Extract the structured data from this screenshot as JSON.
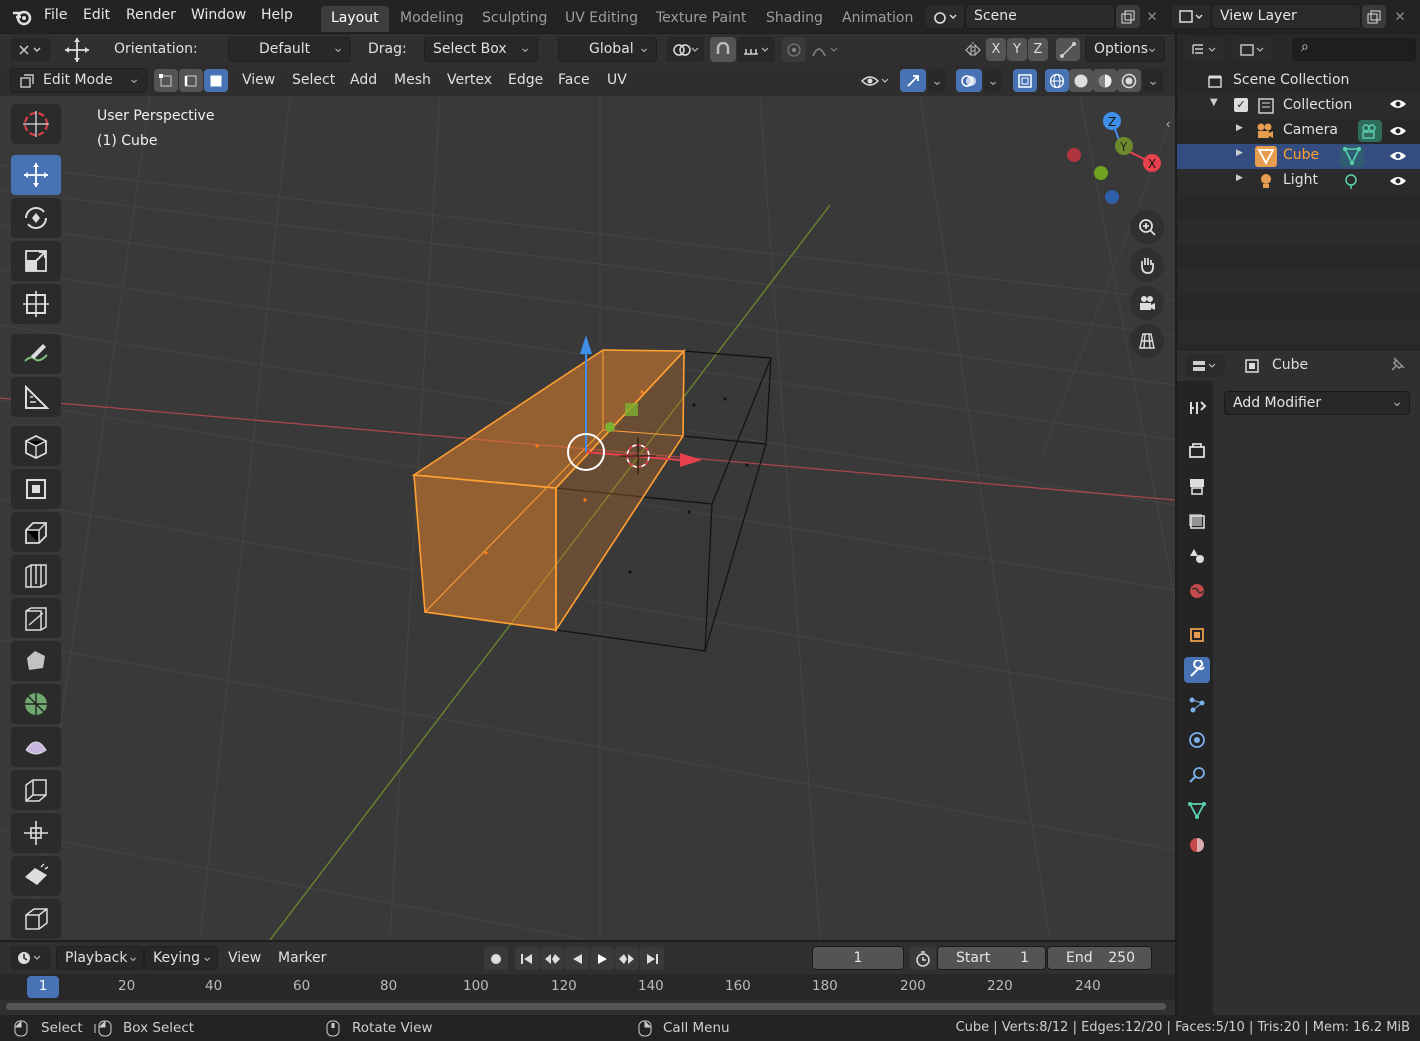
{
  "topbar": {
    "menus": [
      "File",
      "Edit",
      "Render",
      "Window",
      "Help"
    ],
    "workspaces": [
      "Layout",
      "Modeling",
      "Sculpting",
      "UV Editing",
      "Texture Paint",
      "Shading",
      "Animation"
    ],
    "active_workspace": "Layout",
    "scene": "Scene",
    "view_layer": "View Layer"
  },
  "header1": {
    "orientation_label": "Orientation:",
    "orientation_value": "Default",
    "drag_label": "Drag:",
    "drag_value": "Select Box",
    "transform_orientation": "Global",
    "axes": [
      "X",
      "Y",
      "Z"
    ],
    "options": "Options"
  },
  "header2": {
    "mode": "Edit Mode",
    "menus": [
      "View",
      "Select",
      "Add",
      "Mesh",
      "Vertex",
      "Edge",
      "Face",
      "UV"
    ]
  },
  "viewport": {
    "perspective": "User Perspective",
    "object": "(1) Cube",
    "gizmo_axes": [
      "Z",
      "Y",
      "X"
    ]
  },
  "outliner": {
    "root": "Scene Collection",
    "collection": "Collection",
    "items": [
      "Camera",
      "Cube",
      "Light"
    ],
    "selected": "Cube"
  },
  "properties": {
    "object_name": "Cube",
    "add_modifier": "Add Modifier"
  },
  "timeline": {
    "menus": [
      "Playback",
      "Keying",
      "View",
      "Marker"
    ],
    "current_frame": "1",
    "start_label": "Start",
    "start": "1",
    "end_label": "End",
    "end": "250",
    "ruler": [
      "20",
      "40",
      "60",
      "80",
      "100",
      "120",
      "140",
      "160",
      "180",
      "200",
      "220",
      "240"
    ],
    "playhead": "1"
  },
  "statusbar": {
    "select": "Select",
    "box_select": "Box Select",
    "rotate_view": "Rotate View",
    "call_menu": "Call Menu",
    "stats": "Cube | Verts:8/12 | Edges:12/20 | Faces:5/10 | Tris:20 | Mem: 16.2 MiB"
  },
  "colors": {
    "accent": "#4772b3",
    "selection": "#ffa033",
    "x_axis": "#e8414e",
    "y_axis": "#7cb030",
    "z_axis": "#3f8ee8"
  }
}
